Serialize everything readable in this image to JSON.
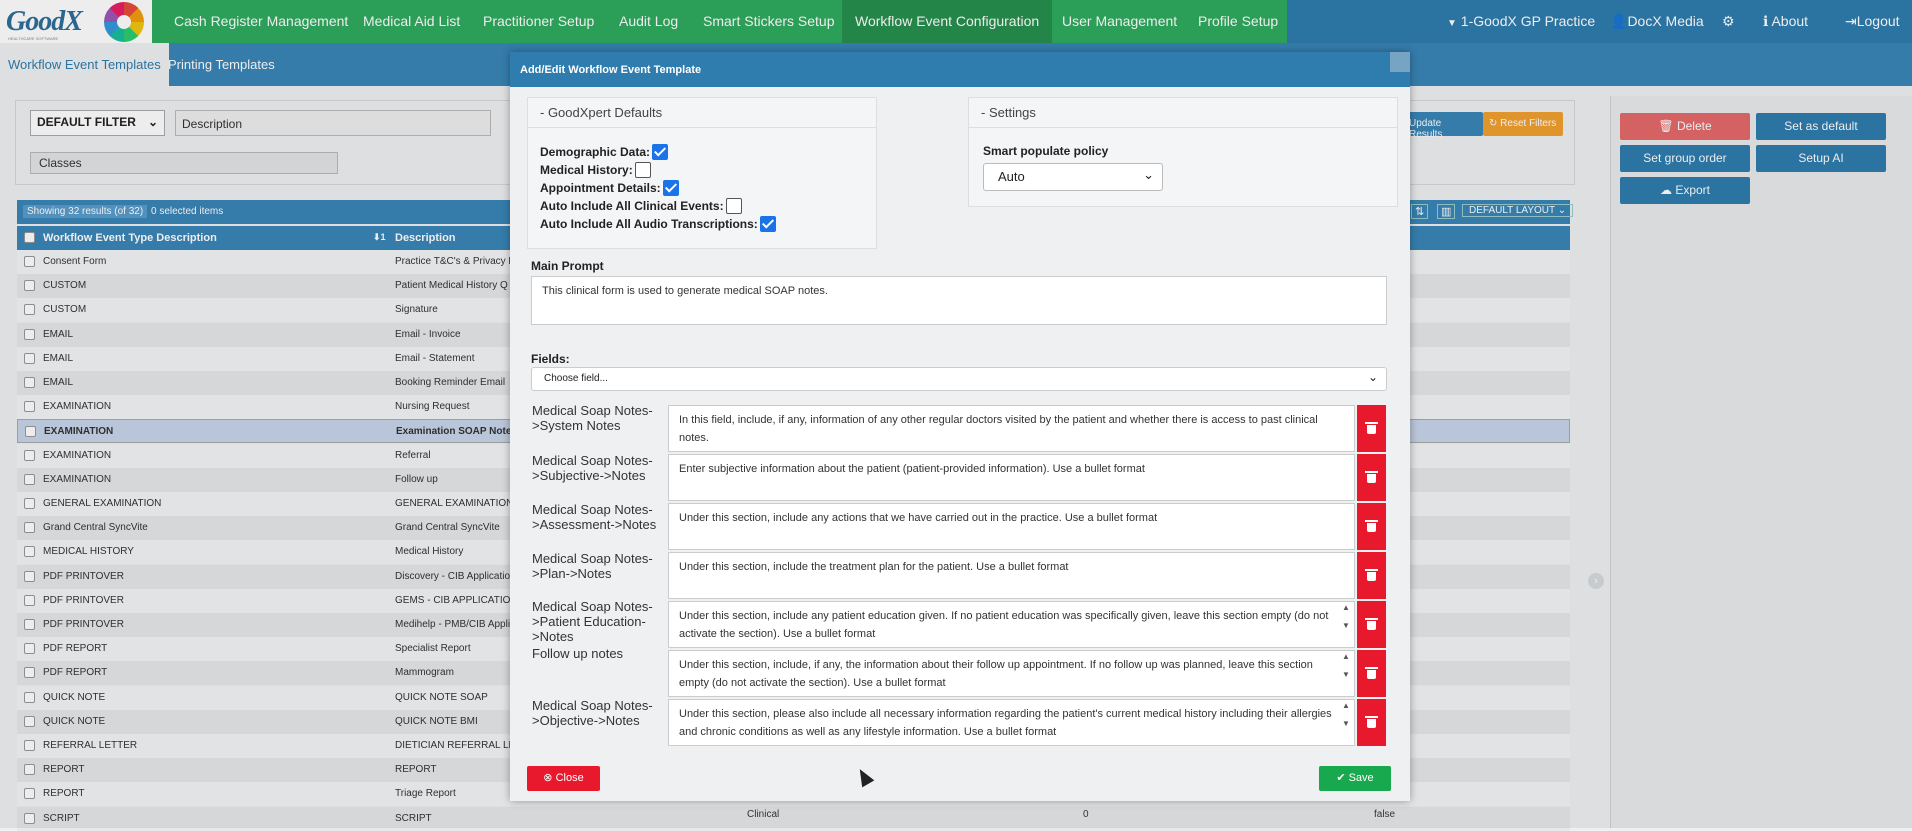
{
  "app": {
    "logo_text": "GoodX",
    "logo_sub": "HEALTHCARE SOFTWARE"
  },
  "nav": {
    "items": [
      "Cash Register Management",
      "Medical Aid List",
      "Practitioner Setup",
      "Audit Log",
      "Smart Stickers Setup",
      "Workflow Event Configuration",
      "User Management",
      "Profile Setup"
    ],
    "right": {
      "practice": "1-GoodX GP Practice",
      "user": "DocX Media",
      "about": "About",
      "logout": "Logout"
    }
  },
  "subtabs": [
    "Workflow Event Templates",
    "Printing Templates"
  ],
  "filters": {
    "default_filter": "DEFAULT FILTER",
    "description_placeholder": "Description",
    "classes_placeholder": "Classes",
    "update_results": "Update Results",
    "reset_filters": "Reset Filters"
  },
  "table": {
    "showing": "Showing 32 results (of 32)",
    "selected": "0 selected items",
    "layout": "DEFAULT LAYOUT",
    "headers": [
      "Workflow Event Type Description",
      "Description"
    ],
    "rows": [
      [
        "Consent Form",
        "Practice T&C's & Privacy P"
      ],
      [
        "CUSTOM",
        "Patient Medical History Q"
      ],
      [
        "CUSTOM",
        "Signature"
      ],
      [
        "EMAIL",
        "Email - Invoice"
      ],
      [
        "EMAIL",
        "Email - Statement"
      ],
      [
        "EMAIL",
        "Booking Reminder Email"
      ],
      [
        "EXAMINATION",
        "Nursing Request"
      ],
      [
        "EXAMINATION",
        "Examination SOAP Notes"
      ],
      [
        "EXAMINATION",
        "Referral"
      ],
      [
        "EXAMINATION",
        "Follow up"
      ],
      [
        "GENERAL EXAMINATION",
        "GENERAL EXAMINATION"
      ],
      [
        "Grand Central SyncVite",
        "Grand Central SyncVite"
      ],
      [
        "MEDICAL HISTORY",
        "Medical History"
      ],
      [
        "PDF PRINTOVER",
        "Discovery - CIB Applicatio"
      ],
      [
        "PDF PRINTOVER",
        "GEMS - CIB APPLICATION"
      ],
      [
        "PDF PRINTOVER",
        "Medihelp - PMB/CIB Appli"
      ],
      [
        "PDF REPORT",
        "Specialist Report"
      ],
      [
        "PDF REPORT",
        "Mammogram"
      ],
      [
        "QUICK NOTE",
        "QUICK NOTE SOAP"
      ],
      [
        "QUICK NOTE",
        "QUICK NOTE BMI"
      ],
      [
        "REFERRAL LETTER",
        "DIETICIAN REFERRAL LET"
      ],
      [
        "REPORT",
        "REPORT"
      ],
      [
        "REPORT",
        "Triage Report"
      ],
      [
        "SCRIPT",
        "SCRIPT"
      ]
    ],
    "last_row_extra": {
      "category": "Clinical",
      "count": "0",
      "flag": "false"
    }
  },
  "right_panel": {
    "delete": "Delete",
    "set_default": "Set as default",
    "set_group_order": "Set group order",
    "setup_ai": "Setup AI",
    "export": "Export"
  },
  "modal": {
    "title": "Add/Edit Workflow Event Template",
    "defaults_title": "- GoodXpert Defaults",
    "settings_title": "- Settings",
    "checkboxes": [
      {
        "label": "Demographic Data:",
        "checked": true
      },
      {
        "label": "Medical History:",
        "checked": false
      },
      {
        "label": "Appointment Details:",
        "checked": true
      },
      {
        "label": "Auto Include All Clinical Events:",
        "checked": false
      },
      {
        "label": "Auto Include All Audio Transcriptions:",
        "checked": true
      }
    ],
    "smart_populate_label": "Smart populate policy",
    "smart_populate_value": "Auto",
    "main_prompt_label": "Main Prompt",
    "main_prompt_value": "This clinical form is used to generate medical SOAP notes.",
    "fields_label": "Fields:",
    "choose_field": "Choose field...",
    "fields": [
      {
        "label": "Medical Soap Notes->System Notes",
        "value": "In this field, include, if any, information of any other regular doctors visited by the patient and whether there is access to past clinical notes."
      },
      {
        "label": "Medical Soap Notes->Subjective->Notes",
        "value": "Enter subjective information about the patient (patient-provided information). Use a bullet format"
      },
      {
        "label": "Medical Soap Notes->Assessment->Notes",
        "value": "Under this section, include any actions that we have carried out in the practice. Use a bullet format"
      },
      {
        "label": "Medical Soap Notes->Plan->Notes",
        "value": "Under this section, include the treatment plan for the patient. Use a bullet format"
      },
      {
        "label": "Medical Soap Notes->Patient Education->Notes",
        "value": "Under this section, include any patient education given. If no patient education was specifically given, leave this section empty (do not activate the section). Use a bullet format"
      },
      {
        "label": "Follow up notes",
        "value": "Under this section, include, if any, the information about their follow up appointment. If no follow up was planned, leave this section empty (do not activate the section). Use a bullet format"
      },
      {
        "label": "Medical Soap Notes->Objective->Notes",
        "value": "Under this section, please also include all necessary information regarding the patient's current medical history including their allergies and chronic conditions as well as any lifestyle information. Use a bullet format"
      }
    ],
    "close": "Close",
    "save": "Save"
  },
  "colors": {
    "nav_green": "#2faa5e",
    "nav_blue": "#2f7cae",
    "danger": "#e8192c",
    "success": "#18a84d",
    "orange": "#f0a030"
  }
}
